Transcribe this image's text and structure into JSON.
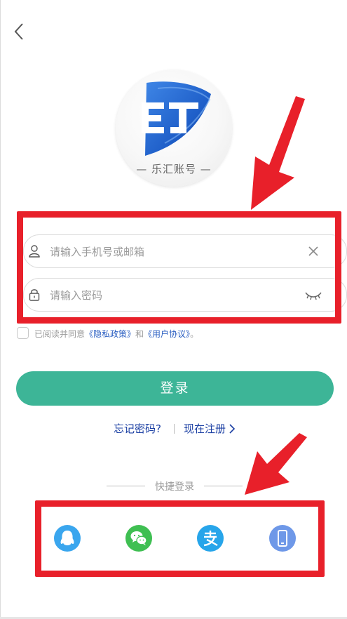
{
  "logo": {
    "mark": "EJ",
    "caption": "— 乐汇账号 —"
  },
  "form": {
    "account_placeholder": "请输入手机号或邮箱",
    "password_placeholder": "请输入密码"
  },
  "agreement": {
    "prefix": "已阅读并同意",
    "privacy": "《隐私政策》",
    "and": "和",
    "terms": "《用户协议》",
    "suffix": "。"
  },
  "login_button": "登录",
  "links": {
    "forgot": "忘记密码?",
    "register": "现在注册"
  },
  "quick_login": {
    "title": "快捷登录",
    "providers": [
      "qq-icon",
      "wechat-icon",
      "alipay-icon",
      "phone-icon"
    ]
  },
  "colors": {
    "primary": "#3db597",
    "link": "#1b3fa3",
    "annotation_red": "#e8202a",
    "qq": "#3aa6ee",
    "wechat": "#3fbf52",
    "alipay": "#27a5ea",
    "phone": "#6e98e8"
  }
}
